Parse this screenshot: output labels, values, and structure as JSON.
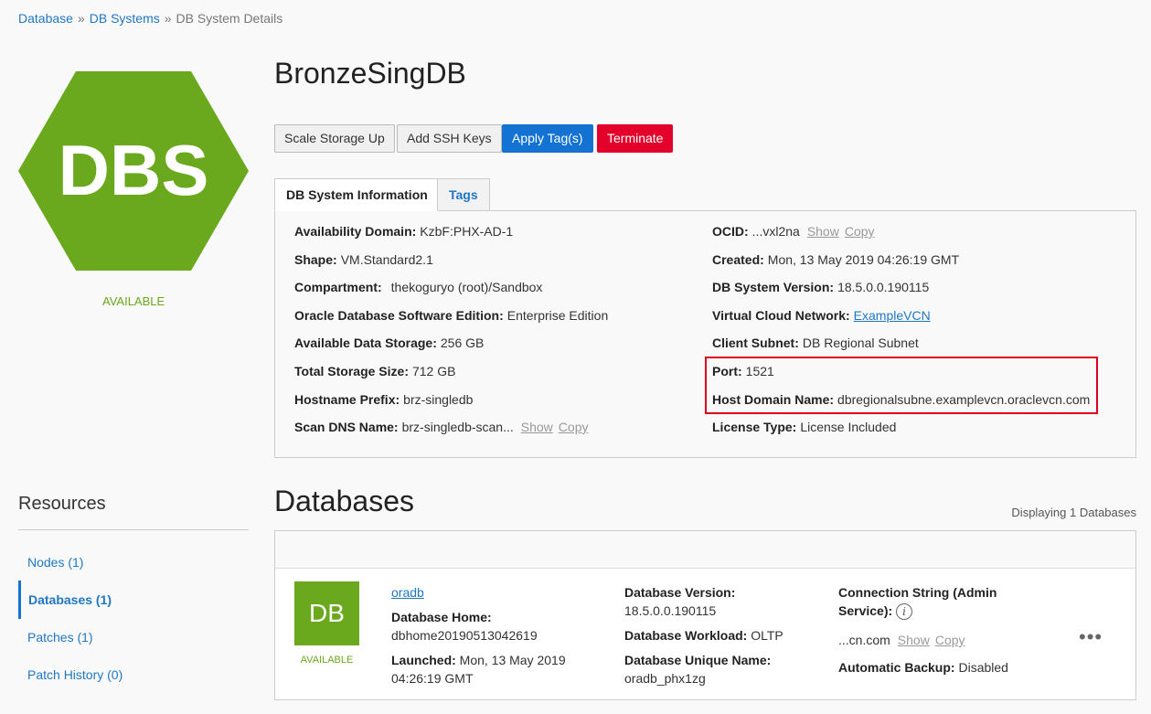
{
  "breadcrumb": {
    "items": [
      "Database",
      "DB Systems",
      "DB System Details"
    ],
    "separator": "»"
  },
  "system": {
    "icon_text": "DBS",
    "status": "AVAILABLE",
    "name": "BronzeSingDB"
  },
  "actions": {
    "scale_storage": "Scale Storage Up",
    "add_ssh": "Add SSH Keys",
    "apply_tags": "Apply Tag(s)",
    "terminate": "Terminate"
  },
  "tabs": {
    "info": "DB System Information",
    "tags": "Tags"
  },
  "info_left": [
    {
      "label": "Availability Domain:",
      "value": "KzbF:PHX-AD-1"
    },
    {
      "label": "Shape:",
      "value": "VM.Standard2.1"
    },
    {
      "label": "Compartment:",
      "value": "thekoguryo (root)/Sandbox"
    },
    {
      "label": "Oracle Database Software Edition:",
      "value": "Enterprise Edition"
    },
    {
      "label": "Available Data Storage:",
      "value": "256 GB"
    },
    {
      "label": "Total Storage Size:",
      "value": "712 GB"
    },
    {
      "label": "Hostname Prefix:",
      "value": "brz-singledb"
    },
    {
      "label": "Scan DNS Name:",
      "value": "brz-singledb-scan...",
      "show": "Show",
      "copy": "Copy"
    }
  ],
  "info_right": [
    {
      "label": "OCID:",
      "value": "...vxl2na",
      "show": "Show",
      "copy": "Copy"
    },
    {
      "label": "Created:",
      "value": "Mon, 13 May 2019 04:26:19 GMT"
    },
    {
      "label": "DB System Version:",
      "value": "18.5.0.0.190115"
    },
    {
      "label": "Virtual Cloud Network:",
      "value": "ExampleVCN"
    },
    {
      "label": "Client Subnet:",
      "value": "DB Regional Subnet"
    },
    {
      "label": "Port:",
      "value": "1521"
    },
    {
      "label": "Host Domain Name:",
      "value": "dbregionalsubne.examplevcn.oraclevcn.com"
    },
    {
      "label": "License Type:",
      "value": "License Included"
    }
  ],
  "resources": {
    "title": "Resources",
    "items": [
      "Nodes (1)",
      "Databases (1)",
      "Patches (1)",
      "Patch History (0)"
    ]
  },
  "databases": {
    "title": "Databases",
    "count_text": "Displaying 1 Databases",
    "row": {
      "tile_text": "DB",
      "status": "AVAILABLE",
      "name": "oradb",
      "home_label": "Database Home:",
      "home_value": "dbhome20190513042619",
      "launched_label": "Launched:",
      "launched_value_1": "Mon, 13 May 2019",
      "launched_value_2": "04:26:19 GMT",
      "version_label": "Database Version:",
      "version_value": "18.5.0.0.190115",
      "workload_label": "Database Workload:",
      "workload_value": "OLTP",
      "unique_label": "Database Unique Name:",
      "unique_value": "oradb_phx1zg",
      "conn_label_1": "Connection String (Admin",
      "conn_label_2": "Service):",
      "conn_value": "...cn.com",
      "show": "Show",
      "copy": "Copy",
      "backup_label": "Automatic Backup:",
      "backup_value": "Disabled",
      "menu": "•••"
    }
  }
}
